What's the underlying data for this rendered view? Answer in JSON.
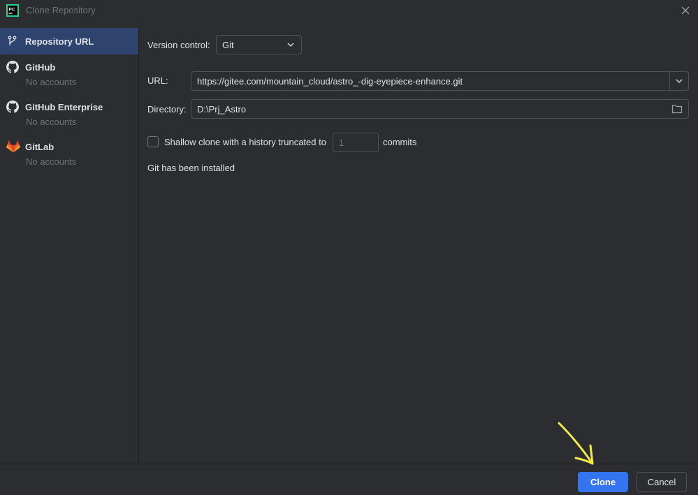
{
  "window": {
    "title": "Clone Repository",
    "app_icon_text": "PC"
  },
  "sidebar": {
    "items": [
      {
        "label": "Repository URL",
        "sub": "",
        "icon": "vcs-branch-icon",
        "selected": true
      },
      {
        "label": "GitHub",
        "sub": "No accounts",
        "icon": "github-icon",
        "selected": false
      },
      {
        "label": "GitHub Enterprise",
        "sub": "No accounts",
        "icon": "github-enterprise-icon",
        "selected": false
      },
      {
        "label": "GitLab",
        "sub": "No accounts",
        "icon": "gitlab-icon",
        "selected": false
      }
    ]
  },
  "form": {
    "version_control_label": "Version control:",
    "version_control_value": "Git",
    "url_label": "URL:",
    "url_value": "https://gitee.com/mountain_cloud/astro_-dig-eyepiece-enhance.git",
    "directory_label": "Directory:",
    "directory_value": "D:\\Prj_Astro",
    "shallow_label": "Shallow clone with a history truncated to",
    "shallow_checked": false,
    "commits_value": "1",
    "commits_label": "commits",
    "status_text": "Git has been installed"
  },
  "footer": {
    "clone_label": "Clone",
    "cancel_label": "Cancel"
  },
  "colors": {
    "background": "#2b2d30",
    "selected": "#2e436e",
    "accent": "#3574f0",
    "annotation": "#f5e94a",
    "gitlab": "#e2432a"
  }
}
